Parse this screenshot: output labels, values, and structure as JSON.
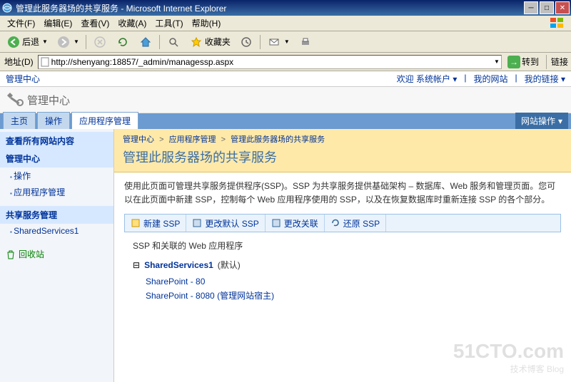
{
  "window": {
    "title": "管理此服务器场的共享服务 - Microsoft Internet Explorer"
  },
  "menus": {
    "file": "文件(F)",
    "edit": "编辑(E)",
    "view": "查看(V)",
    "favorites": "收藏(A)",
    "tools": "工具(T)",
    "help": "帮助(H)"
  },
  "toolbar": {
    "back": "后退",
    "favorites": "收藏夹"
  },
  "address": {
    "label": "地址(D)",
    "url": "http://shenyang:18857/_admin/managessp.aspx",
    "go": "转到",
    "links": "链接"
  },
  "topnav": {
    "left": "管理中心",
    "welcome": "欢迎 系统帐户",
    "mysite": "我的网站",
    "mylinks": "我的链接"
  },
  "header": {
    "site_title": "管理中心"
  },
  "tabs": {
    "home": "主页",
    "operations": "操作",
    "app_mgmt": "应用程序管理",
    "site_actions": "网站操作"
  },
  "leftnav": {
    "view_all": "查看所有网站内容",
    "admin_center": "管理中心",
    "operations": "操作",
    "app_mgmt": "应用程序管理",
    "shared_services": "共享服务管理",
    "ssp1": "SharedServices1",
    "recycle": "回收站"
  },
  "breadcrumb": {
    "b1": "管理中心",
    "b2": "应用程序管理",
    "b3": "管理此服务器场的共享服务"
  },
  "page_title": "管理此服务器场的共享服务",
  "desc": "使用此页面可管理共享服务提供程序(SSP)。SSP 为共享服务提供基础架构 – 数据库、Web 服务和管理页面。您可以在此页面中新建 SSP，控制每个 Web 应用程序使用的 SSP，以及在恢复数据库时重新连接 SSP 的各个部分。",
  "actions": {
    "new_ssp": "新建 SSP",
    "change_default": "更改默认 SSP",
    "change_assoc": "更改关联",
    "restore": "还原 SSP"
  },
  "subhead": "SSP 和关联的 Web 应用程序",
  "ssp": {
    "name": "SharedServices1",
    "default": "(默认)",
    "app1": "SharePoint - 80",
    "app2": "SharePoint - 8080  (管理网站宿主)"
  },
  "watermark": {
    "big": "51CTO.com",
    "small": "技术博客   Blog"
  }
}
